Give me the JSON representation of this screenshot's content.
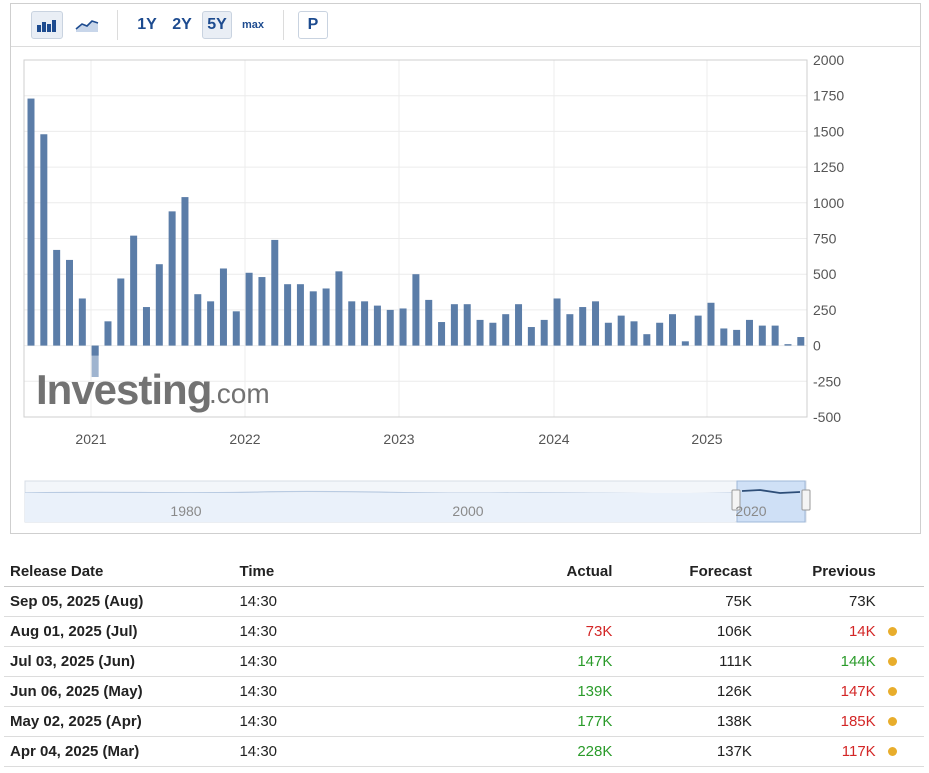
{
  "toolbar": {
    "range_buttons": [
      "1Y",
      "2Y",
      "5Y",
      "max"
    ],
    "active_range": "5Y",
    "p_button": "P"
  },
  "watermark": {
    "brand": "Investing",
    "suffix": ".com"
  },
  "chart_data": {
    "type": "bar",
    "y_axis_position": "right",
    "ylim": [
      -500,
      2000
    ],
    "yticks": [
      "2000",
      "1750",
      "1500",
      "1250",
      "1000",
      "750",
      "500",
      "250",
      "0",
      "-250",
      "-500"
    ],
    "xticks": [
      "2021",
      "2022",
      "2023",
      "2024",
      "2025"
    ],
    "grid": true,
    "bar_color": "#5b7da8",
    "negative_bar_color": "#9fb4cf",
    "values": [
      1730,
      1480,
      670,
      600,
      330,
      -220,
      170,
      470,
      770,
      270,
      570,
      940,
      1040,
      360,
      310,
      540,
      240,
      510,
      480,
      740,
      430,
      430,
      380,
      400,
      520,
      310,
      310,
      280,
      250,
      260,
      500,
      320,
      165,
      290,
      290,
      180,
      160,
      220,
      290,
      130,
      180,
      330,
      220,
      270,
      310,
      160,
      210,
      170,
      80,
      160,
      220,
      30,
      210,
      300,
      120,
      110,
      180,
      140,
      140,
      10,
      60
    ]
  },
  "navigator": {
    "labels": [
      "1980",
      "2000",
      "2020"
    ]
  },
  "table": {
    "headers": {
      "release_date": "Release Date",
      "time": "Time",
      "actual": "Actual",
      "forecast": "Forecast",
      "previous": "Previous"
    },
    "rows": [
      {
        "date": "Sep 05, 2025 (Aug)",
        "time": "14:30",
        "actual": "",
        "actual_status": "",
        "forecast": "75K",
        "previous": "73K",
        "previous_status": "",
        "dot": false
      },
      {
        "date": "Aug 01, 2025 (Jul)",
        "time": "14:30",
        "actual": "73K",
        "actual_status": "red",
        "forecast": "106K",
        "previous": "14K",
        "previous_status": "red",
        "dot": true
      },
      {
        "date": "Jul 03, 2025 (Jun)",
        "time": "14:30",
        "actual": "147K",
        "actual_status": "green",
        "forecast": "111K",
        "previous": "144K",
        "previous_status": "green",
        "dot": true
      },
      {
        "date": "Jun 06, 2025 (May)",
        "time": "14:30",
        "actual": "139K",
        "actual_status": "green",
        "forecast": "126K",
        "previous": "147K",
        "previous_status": "red",
        "dot": true
      },
      {
        "date": "May 02, 2025 (Apr)",
        "time": "14:30",
        "actual": "177K",
        "actual_status": "green",
        "forecast": "138K",
        "previous": "185K",
        "previous_status": "red",
        "dot": true
      },
      {
        "date": "Apr 04, 2025 (Mar)",
        "time": "14:30",
        "actual": "228K",
        "actual_status": "green",
        "forecast": "137K",
        "previous": "117K",
        "previous_status": "red",
        "dot": true
      }
    ]
  }
}
